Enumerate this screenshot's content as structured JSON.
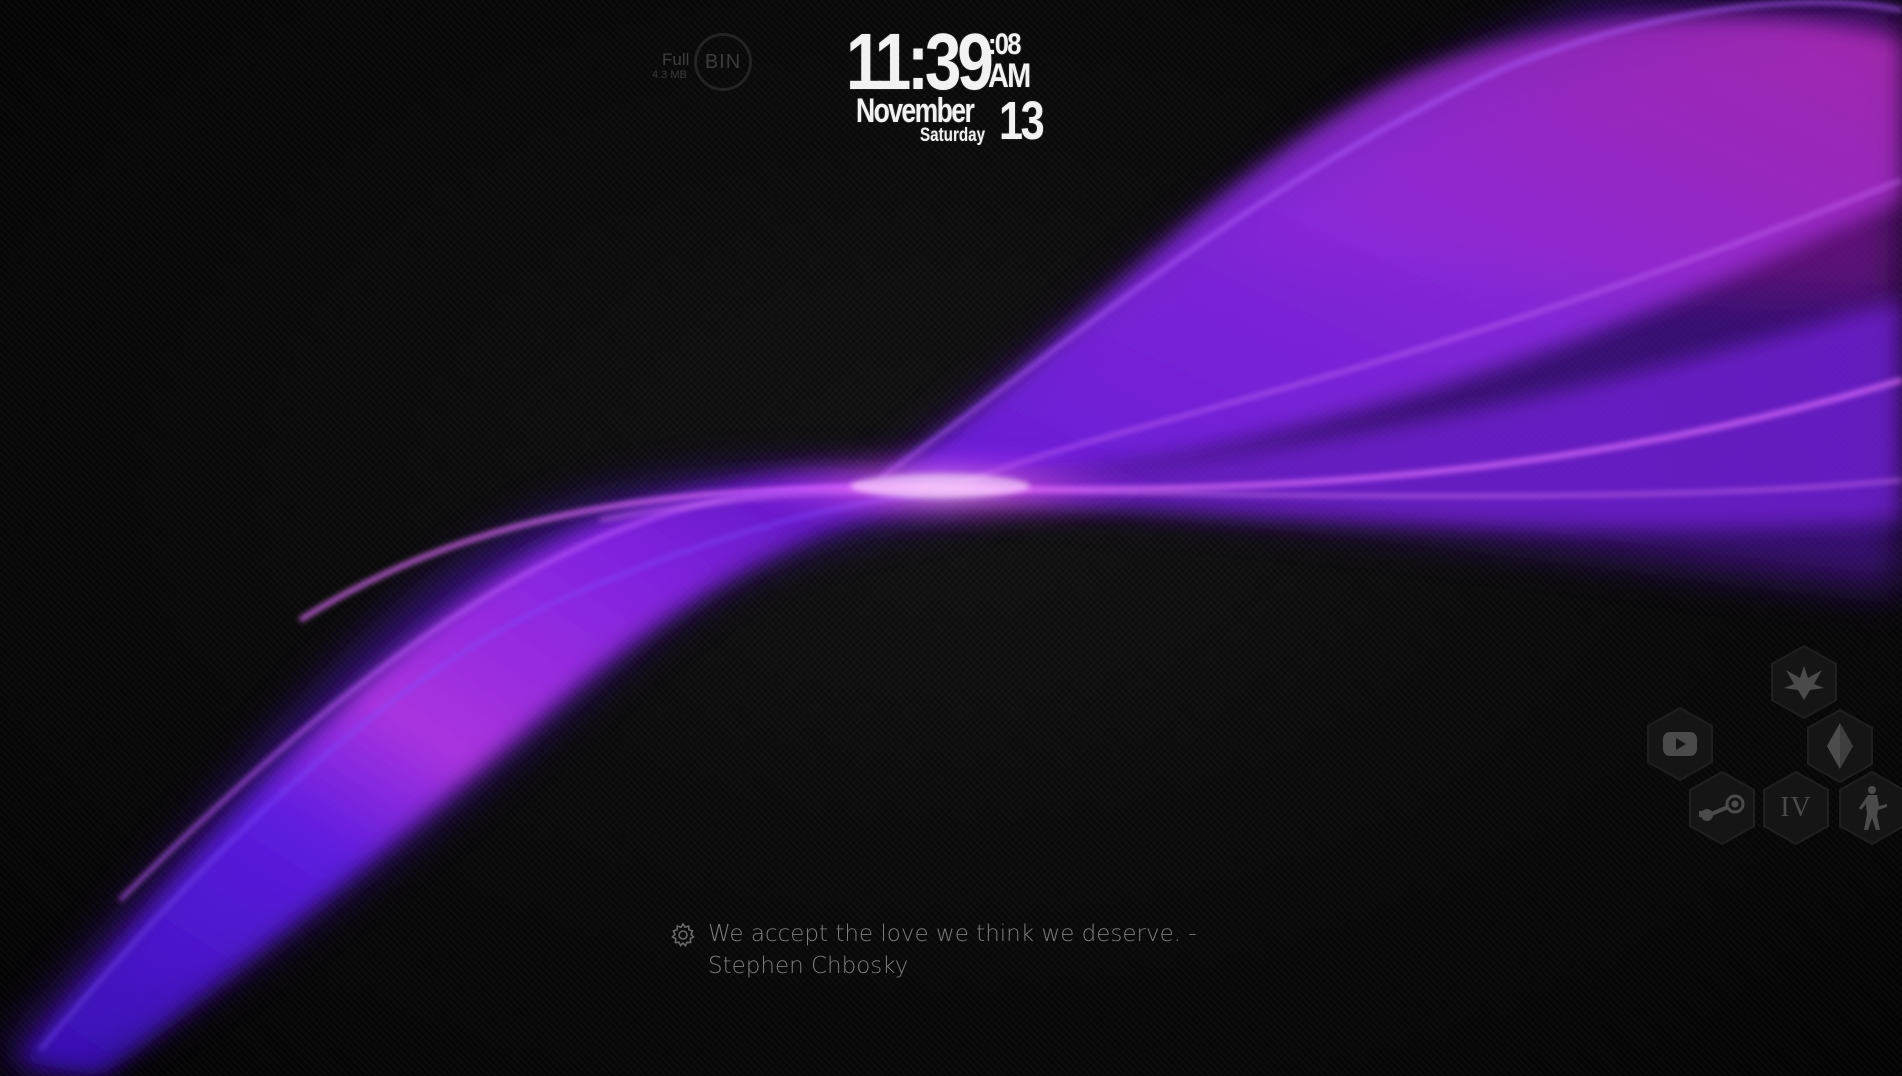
{
  "desktop": {
    "wallpaper": "purple-ribbon-wave",
    "accent_colors": [
      "#6a1fff",
      "#b030ff",
      "#ff40ff"
    ]
  },
  "recycle_bin": {
    "status": "Full",
    "size": "4.3 MB",
    "label": "BIN"
  },
  "clock": {
    "hours_minutes": "11:39",
    "seconds": ":08",
    "ampm": "AM",
    "month": "November",
    "day": "13",
    "weekday": "Saturday"
  },
  "quote": {
    "icon": "gear-icon",
    "text": "We accept the love we think we deserve. - Stephen Chbosky"
  },
  "launcher": {
    "items": [
      {
        "name": "elite-dangerous",
        "icon": "elite-emblem-icon"
      },
      {
        "name": "youtube",
        "icon": "youtube-icon"
      },
      {
        "name": "no-mans-sky",
        "icon": "diamond-crystal-icon"
      },
      {
        "name": "steam",
        "icon": "steam-icon"
      },
      {
        "name": "gta-iv",
        "icon": "roman-four-icon",
        "label": "IV"
      },
      {
        "name": "counter-strike",
        "icon": "soldier-icon"
      }
    ]
  }
}
